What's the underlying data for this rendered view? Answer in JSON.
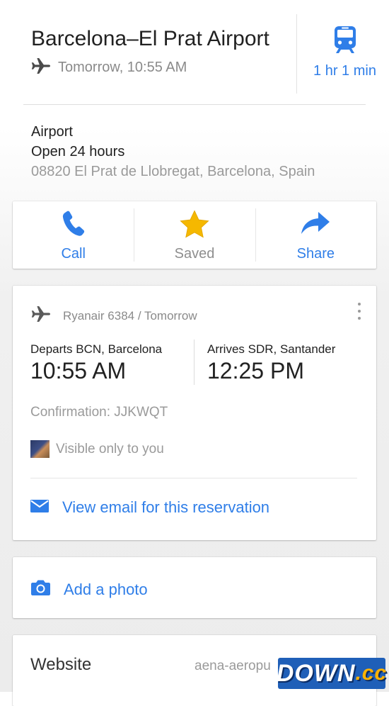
{
  "header": {
    "title": "Barcelona–El Prat Airport",
    "subtitle": "Tomorrow, 10:55 AM",
    "subtitle_icon": "airplane-icon",
    "transit": {
      "icon": "train-icon",
      "duration": "1 hr 1 min"
    }
  },
  "place": {
    "type": "Airport",
    "hours": "Open 24 hours",
    "address": "08820 El Prat de Llobregat, Barcelona, Spain"
  },
  "actions": [
    {
      "label": "Call",
      "icon": "phone-icon"
    },
    {
      "label": "Saved",
      "icon": "star-icon"
    },
    {
      "label": "Share",
      "icon": "share-icon"
    }
  ],
  "flight": {
    "header": "Ryanair 6384 / Tomorrow",
    "departs_label": "Departs BCN, Barcelona",
    "departs_time": "10:55 AM",
    "arrives_label": "Arrives SDR, Santander",
    "arrives_time": "12:25 PM",
    "confirmation": "Confirmation: JJKWQT",
    "visibility": "Visible only to you",
    "email_link": "View email for this reservation"
  },
  "photo": {
    "label": "Add a photo"
  },
  "website": {
    "label": "Website",
    "value": "aena-aeropu"
  },
  "watermark": {
    "main": "DOWN",
    "suffix": ".cc"
  },
  "colors": {
    "accent": "#2f7ee8",
    "star": "#f5b800",
    "text": "#212121",
    "muted": "#9a9a9a"
  }
}
